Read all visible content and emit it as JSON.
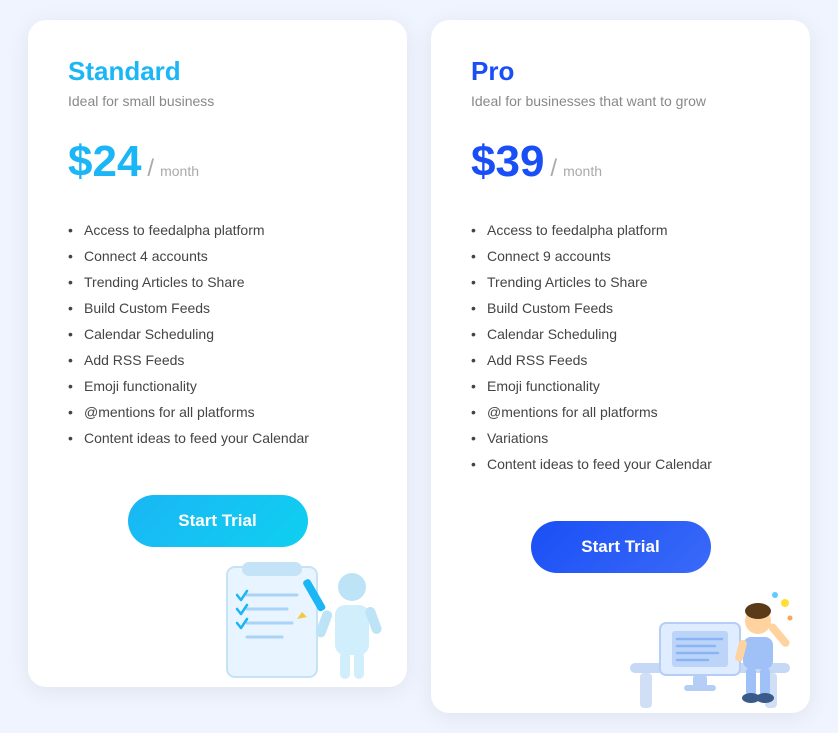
{
  "cards": [
    {
      "id": "standard",
      "plan_name": "Standard",
      "plan_tagline": "Ideal for small business",
      "price_amount": "$24",
      "price_slash": "/",
      "price_period": "month",
      "features": [
        "Access to feedalpha platform",
        "Connect 4 accounts",
        "Trending Articles to Share",
        "Build Custom Feeds",
        "Calendar Scheduling",
        "Add RSS Feeds",
        "Emoji functionality",
        "@mentions for all platforms",
        "Content ideas to feed your Calendar"
      ],
      "cta_label": "Start Trial",
      "cta_type": "standard"
    },
    {
      "id": "pro",
      "plan_name": "Pro",
      "plan_tagline": "Ideal for businesses that want to grow",
      "price_amount": "$39",
      "price_slash": "/",
      "price_period": "month",
      "features": [
        "Access to feedalpha platform",
        "Connect 9 accounts",
        "Trending Articles to Share",
        "Build Custom Feeds",
        "Calendar Scheduling",
        "Add RSS Feeds",
        "Emoji functionality",
        "@mentions for all platforms",
        "Variations",
        "Content ideas to feed your Calendar"
      ],
      "cta_label": "Start Trial",
      "cta_type": "pro"
    }
  ]
}
